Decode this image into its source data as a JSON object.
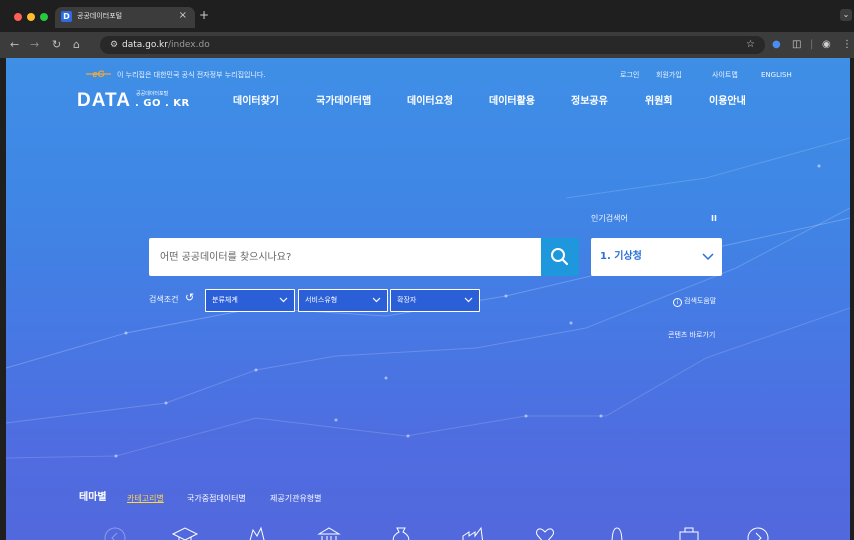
{
  "browser": {
    "tab_title": "공공데이터포털",
    "tab_favicon": "D",
    "tab_close": "×",
    "new_tab": "+",
    "url_host": "data.go.kr",
    "url_path": "/index.do"
  },
  "header": {
    "gov_notice": "이 누리집은 대한민국 공식 전자정부 누리집입니다.",
    "util_links": [
      "로그인",
      "회원가입",
      "사이트맵",
      "ENGLISH"
    ],
    "logo_main": "DATA",
    "logo_sub_small": "공공데이터포털",
    "logo_sub_large": ". GO . KR",
    "nav": [
      "데이터찾기",
      "국가데이터맵",
      "데이터요청",
      "데이터활용",
      "정보공유",
      "위원회",
      "이용안내"
    ]
  },
  "search": {
    "placeholder": "어떤 공공데이터를 찾으시나요?",
    "popular_label": "인기검색어",
    "popular_pause": "II",
    "popular_value": "1. 기상청",
    "conditions_label": "검색조건",
    "filters": [
      "분류체계",
      "서비스유형",
      "확장자"
    ],
    "help_label": "검색도움말",
    "shortcut_label": "콘텐츠 바로가기"
  },
  "theme": {
    "title": "테마별",
    "tabs": [
      "카테고리별",
      "국가중점데이터별",
      "제공기관유형별"
    ],
    "active_tab_index": 0
  },
  "colors": {
    "accent": "#1f97dd",
    "popular_text": "#2a6fdc",
    "active_tab": "#ffd54a"
  }
}
